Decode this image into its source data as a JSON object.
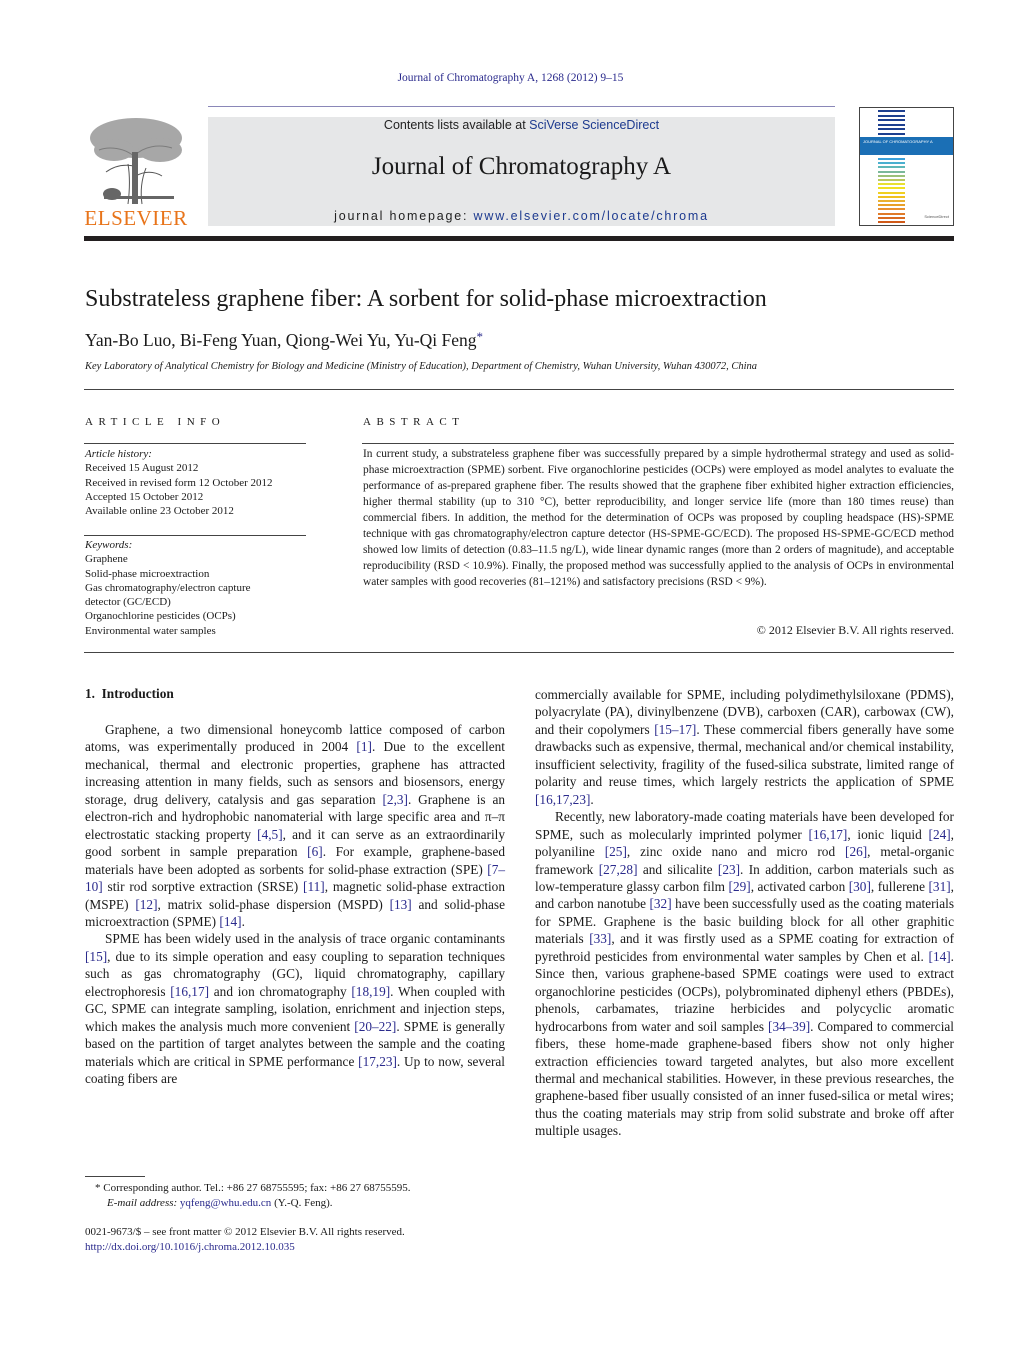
{
  "header": {
    "citation": "Journal of Chromatography A, 1268 (2012) 9–15",
    "contents_prefix": "Contents lists available at ",
    "contents_link": "SciVerse ScienceDirect",
    "journal_name": "Journal of Chromatography A",
    "homepage_prefix": "journal homepage: ",
    "homepage_url": "www.elsevier.com/locate/chroma",
    "publisher_logo_text": "ELSEVIER",
    "cover_band_text": "JOURNAL OF CHROMATOGRAPHY A",
    "cover_badge_text": "ScienceDirect",
    "colors": {
      "publisher_orange": "#e8741a",
      "link_blue": "#2a2a8c",
      "masthead_gray": "#e6e7e8",
      "cover_band_blue": "#1b6fb5"
    }
  },
  "article": {
    "title": "Substrateless graphene fiber: A sorbent for solid-phase microextraction",
    "authors": "Yan-Bo Luo, Bi-Feng Yuan, Qiong-Wei Yu, Yu-Qi Feng",
    "author_mark": "*",
    "affiliation": "Key Laboratory of Analytical Chemistry for Biology and Medicine (Ministry of Education), Department of Chemistry, Wuhan University, Wuhan 430072, China"
  },
  "article_info": {
    "heading": "ARTICLE INFO",
    "history_label": "Article history:",
    "history": [
      "Received 15 August 2012",
      "Received in revised form 12 October 2012",
      "Accepted 15 October 2012",
      "Available online 23 October 2012"
    ],
    "keywords_label": "Keywords:",
    "keywords": [
      "Graphene",
      "Solid-phase microextraction",
      "Gas chromatography/electron capture detector (GC/ECD)",
      "Organochlorine pesticides (OCPs)",
      "Environmental water samples"
    ]
  },
  "abstract": {
    "heading": "ABSTRACT",
    "text": "In current study, a substrateless graphene fiber was successfully prepared by a simple hydrothermal strategy and used as solid-phase microextraction (SPME) sorbent. Five organochlorine pesticides (OCPs) were employed as model analytes to evaluate the performance of as-prepared graphene fiber. The results showed that the graphene fiber exhibited higher extraction efficiencies, higher thermal stability (up to 310 °C), better reproducibility, and longer service life (more than 180 times reuse) than commercial fibers. In addition, the method for the determination of OCPs was proposed by coupling headspace (HS)-SPME technique with gas chromatography/electron capture detector (HS-SPME-GC/ECD). The proposed HS-SPME-GC/ECD method showed low limits of detection (0.83–11.5 ng/L), wide linear dynamic ranges (more than 2 orders of magnitude), and acceptable reproducibility (RSD < 10.9%). Finally, the proposed method was successfully applied to the analysis of OCPs in environmental water samples with good recoveries (81–121%) and satisfactory precisions (RSD < 9%).",
    "copyright": "© 2012 Elsevier B.V. All rights reserved."
  },
  "body": {
    "section_heading": "1.  Introduction",
    "left_paragraphs": [
      [
        {
          "t": "Graphene, a two dimensional honeycomb lattice composed of carbon atoms, was experimentally produced in 2004 "
        },
        {
          "r": "[1]"
        },
        {
          "t": ". Due to the excellent mechanical, thermal and electronic properties, graphene has attracted increasing attention in many fields, such as sensors and biosensors, energy storage, drug delivery, catalysis and gas separation "
        },
        {
          "r": "[2,3]"
        },
        {
          "t": ". Graphene is an electron-rich and hydrophobic nanomaterial with large specific area and π–π electrostatic stacking property "
        },
        {
          "r": "[4,5]"
        },
        {
          "t": ", and it can serve as an extraordinarily good sorbent in sample preparation "
        },
        {
          "r": "[6]"
        },
        {
          "t": ". For example, graphene-based materials have been adopted as sorbents for solid-phase extraction (SPE) "
        },
        {
          "r": "[7–10]"
        },
        {
          "t": " stir rod sorptive extraction (SRSE) "
        },
        {
          "r": "[11]"
        },
        {
          "t": ", magnetic solid-phase extraction (MSPE) "
        },
        {
          "r": "[12]"
        },
        {
          "t": ", matrix solid-phase dispersion (MSPD) "
        },
        {
          "r": "[13]"
        },
        {
          "t": " and solid-phase microextraction (SPME) "
        },
        {
          "r": "[14]"
        },
        {
          "t": "."
        }
      ],
      [
        {
          "t": "SPME has been widely used in the analysis of trace organic contaminants "
        },
        {
          "r": "[15]"
        },
        {
          "t": ", due to its simple operation and easy coupling to separation techniques such as gas chromatography (GC), liquid chromatography, capillary electrophoresis "
        },
        {
          "r": "[16,17]"
        },
        {
          "t": " and ion chromatography "
        },
        {
          "r": "[18,19]"
        },
        {
          "t": ". When coupled with GC, SPME can integrate sampling, isolation, enrichment and injection steps, which makes the analysis much more convenient "
        },
        {
          "r": "[20–22]"
        },
        {
          "t": ". SPME is generally based on the partition of target analytes between the sample and the coating materials which are critical in SPME performance "
        },
        {
          "r": "[17,23]"
        },
        {
          "t": ". Up to now, several coating fibers are"
        }
      ]
    ],
    "right_paragraphs": [
      [
        {
          "t": "commercially available for SPME, including polydimethylsiloxane (PDMS), polyacrylate (PA), divinylbenzene (DVB), carboxen (CAR), carbowax (CW), and their copolymers "
        },
        {
          "r": "[15–17]"
        },
        {
          "t": ". These commercial fibers generally have some drawbacks such as expensive, thermal, mechanical and/or chemical instability, insufficient selectivity, fragility of the fused-silica substrate, limited range of polarity and reuse times, which largely restricts the application of SPME "
        },
        {
          "r": "[16,17,23]"
        },
        {
          "t": "."
        }
      ],
      [
        {
          "t": "Recently, new laboratory-made coating materials have been developed for SPME, such as molecularly imprinted polymer "
        },
        {
          "r": "[16,17]"
        },
        {
          "t": ", ionic liquid "
        },
        {
          "r": "[24]"
        },
        {
          "t": ", polyaniline "
        },
        {
          "r": "[25]"
        },
        {
          "t": ", zinc oxide nano and micro rod "
        },
        {
          "r": "[26]"
        },
        {
          "t": ", metal-organic framework "
        },
        {
          "r": "[27,28]"
        },
        {
          "t": " and silicalite "
        },
        {
          "r": "[23]"
        },
        {
          "t": ". In addition, carbon materials such as low-temperature glassy carbon film "
        },
        {
          "r": "[29]"
        },
        {
          "t": ", activated carbon "
        },
        {
          "r": "[30]"
        },
        {
          "t": ", fullerene "
        },
        {
          "r": "[31]"
        },
        {
          "t": ", and carbon nanotube "
        },
        {
          "r": "[32]"
        },
        {
          "t": " have been successfully used as the coating materials for SPME. Graphene is the basic building block for all other graphitic materials "
        },
        {
          "r": "[33]"
        },
        {
          "t": ", and it was firstly used as a SPME coating for extraction of pyrethroid pesticides from environmental water samples by Chen et al. "
        },
        {
          "r": "[14]"
        },
        {
          "t": ". Since then, various graphene-based SPME coatings were used to extract organochlorine pesticides (OCPs), polybrominated diphenyl ethers (PBDEs), phenols, carbamates, triazine herbicides and polycyclic aromatic hydrocarbons from water and soil samples "
        },
        {
          "r": "[34–39]"
        },
        {
          "t": ". Compared to commercial fibers, these home-made graphene-based fibers show not only higher extraction efficiencies toward targeted analytes, but also more excellent thermal and mechanical stabilities. However, in these previous researches, the graphene-based fiber usually consisted of an inner fused-silica or metal wires; thus the coating materials may strip from solid substrate and broke off after multiple usages."
        }
      ]
    ]
  },
  "footnote": {
    "mark": "*",
    "contact": "Corresponding author. Tel.: +86 27 68755595; fax: +86 27 68755595.",
    "email_label": "E-mail address: ",
    "email": "yqfeng@whu.edu.cn",
    "email_suffix": " (Y.-Q. Feng).",
    "front_matter": "0021-9673/$ – see front matter © 2012 Elsevier B.V. All rights reserved.",
    "doi": "http://dx.doi.org/10.1016/j.chroma.2012.10.035"
  }
}
